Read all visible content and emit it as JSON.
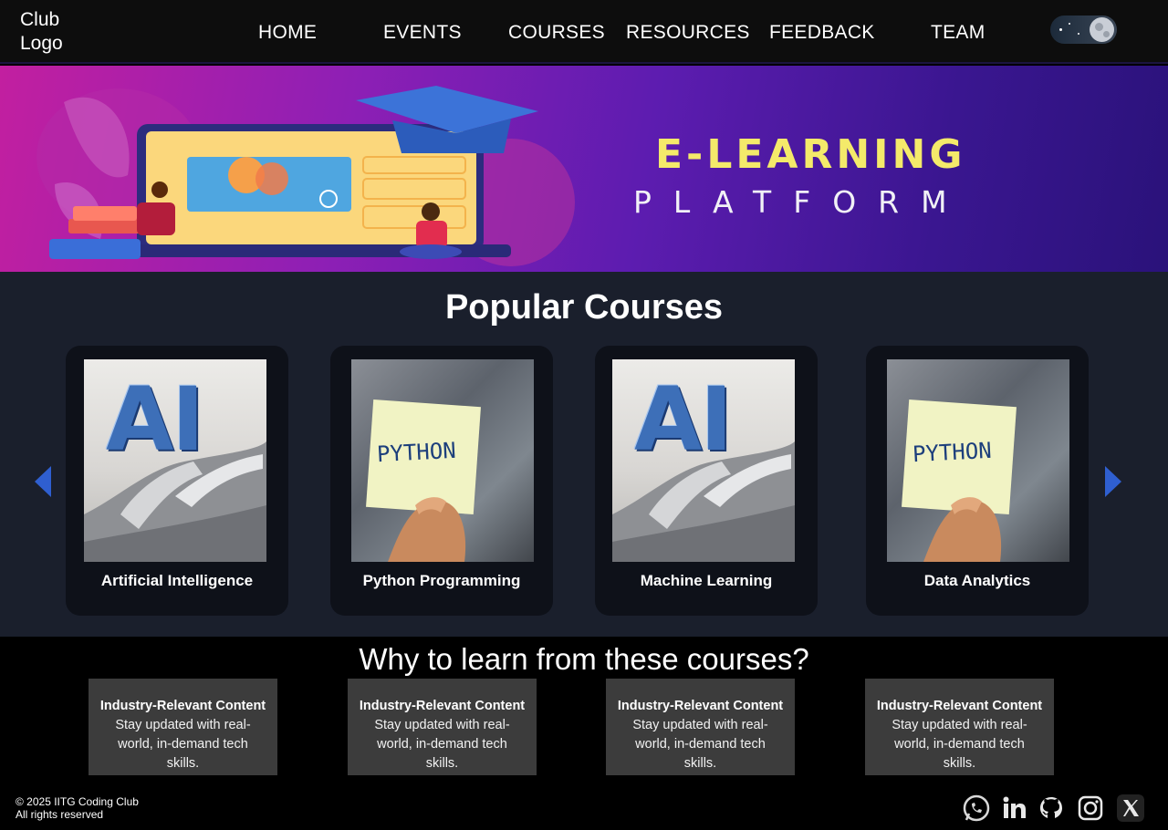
{
  "nav": {
    "logo_line1": "Club",
    "logo_line2": "Logo",
    "links": [
      "HOME",
      "EVENTS",
      "COURSES",
      "RESOURCES",
      "FEEDBACK",
      "TEAM"
    ],
    "theme_toggle_icon": "moon-toggle-icon"
  },
  "hero": {
    "title": "E-LEARNING",
    "subtitle": "PLATFORM",
    "illustration": "laptop-graduation-illustration"
  },
  "courses": {
    "title": "Popular Courses",
    "prev_icon": "chevron-left-icon",
    "next_icon": "chevron-right-icon",
    "items": [
      {
        "label": "Artificial Intelligence",
        "image": "ai-robot-hand"
      },
      {
        "label": "Python Programming",
        "image": "python-sticky-note"
      },
      {
        "label": "Machine Learning",
        "image": "ai-robot-hand"
      },
      {
        "label": "Data Analytics",
        "image": "python-sticky-note"
      }
    ]
  },
  "why": {
    "title": "Why to learn from these courses?",
    "items": [
      {
        "head": "Industry-Relevant Content",
        "text": "Stay updated with real-world, in-demand tech skills."
      },
      {
        "head": "Industry-Relevant Content",
        "text": "Stay updated with real-world, in-demand tech skills."
      },
      {
        "head": "Industry-Relevant Content",
        "text": "Stay updated with real-world, in-demand tech skills."
      },
      {
        "head": "Industry-Relevant Content",
        "text": "Stay updated with real-world, in-demand tech skills."
      }
    ]
  },
  "footer": {
    "copyright": "© 2025 IITG Coding Club",
    "rights": "All rights reserved",
    "social_icons": [
      "whatsapp-icon",
      "linkedin-icon",
      "github-icon",
      "instagram-icon",
      "x-icon"
    ]
  },
  "colors": {
    "accent_blue": "#2f5fd0",
    "hero_title_yellow": "#f4ea6a",
    "courses_bg": "#1a1f2c",
    "card_bg": "#0e1119",
    "why_box_bg": "#3c3c3c"
  }
}
